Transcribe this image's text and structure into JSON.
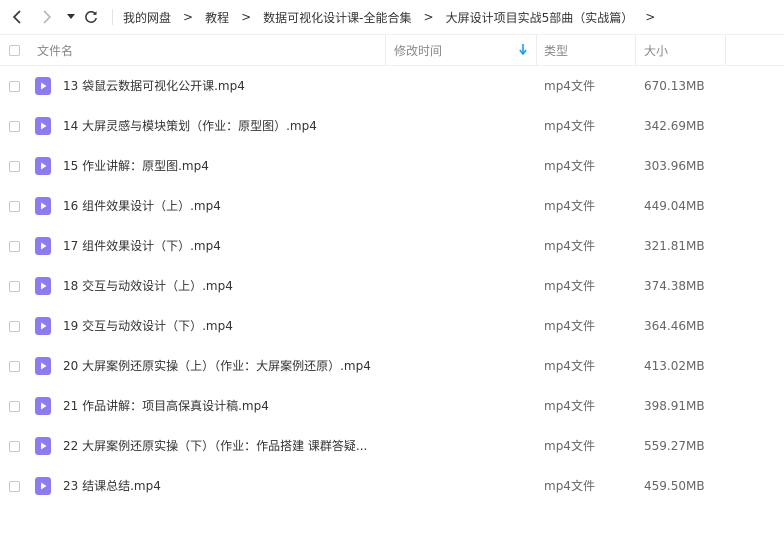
{
  "nav": {
    "back_icon": "chevron-left-icon",
    "forward_icon": "chevron-right-icon",
    "history_icon": "caret-down-icon",
    "refresh_icon": "refresh-icon"
  },
  "breadcrumb": {
    "items": [
      "我的网盘",
      "教程",
      "数据可视化设计课-全能合集",
      "大屏设计项目实战5部曲（实战篇）"
    ],
    "separator": ">"
  },
  "header": {
    "name": "文件名",
    "modified": "修改时间",
    "type": "类型",
    "size": "大小",
    "sort_icon": "arrow-down-icon",
    "sort_color": "#1a9bf0"
  },
  "file_icon_color": "#8c7cf0",
  "files": [
    {
      "name": "13 袋鼠云数据可视化公开课.mp4",
      "type": "mp4文件",
      "size": "670.13MB"
    },
    {
      "name": "14 大屏灵感与模块策划（作业：原型图）.mp4",
      "type": "mp4文件",
      "size": "342.69MB"
    },
    {
      "name": "15 作业讲解：原型图.mp4",
      "type": "mp4文件",
      "size": "303.96MB"
    },
    {
      "name": "16 组件效果设计（上）.mp4",
      "type": "mp4文件",
      "size": "449.04MB"
    },
    {
      "name": "17 组件效果设计（下）.mp4",
      "type": "mp4文件",
      "size": "321.81MB"
    },
    {
      "name": "18 交互与动效设计（上）.mp4",
      "type": "mp4文件",
      "size": "374.38MB"
    },
    {
      "name": "19 交互与动效设计（下）.mp4",
      "type": "mp4文件",
      "size": "364.46MB"
    },
    {
      "name": "20 大屏案例还原实操（上）（作业：大屏案例还原）.mp4",
      "type": "mp4文件",
      "size": "413.02MB"
    },
    {
      "name": "21 作品讲解：项目高保真设计稿.mp4",
      "type": "mp4文件",
      "size": "398.91MB"
    },
    {
      "name": "22 大屏案例还原实操（下）（作业：作品搭建 课群答疑...",
      "type": "mp4文件",
      "size": "559.27MB"
    },
    {
      "name": "23 结课总结.mp4",
      "type": "mp4文件",
      "size": "459.50MB"
    }
  ]
}
